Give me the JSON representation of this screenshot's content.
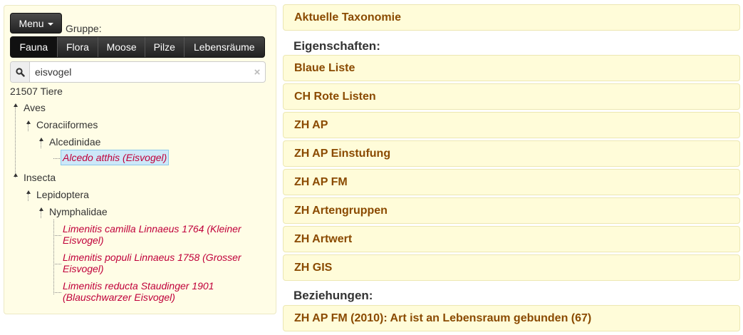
{
  "left": {
    "menu_label": "Menu",
    "gruppe_label": "Gruppe:",
    "groups": [
      "Fauna",
      "Flora",
      "Moose",
      "Pilze",
      "Lebensräume"
    ],
    "active_group": "Fauna",
    "search_value": "eisvogel",
    "count_text": "21507 Tiere",
    "tree": {
      "aves": "Aves",
      "coraciiformes": "Coraciiformes",
      "alcedinidae": "Alcedinidae",
      "alcedo": "Alcedo atthis (Eisvogel)",
      "insecta": "Insecta",
      "lepidoptera": "Lepidoptera",
      "nymphalidae": "Nymphalidae",
      "camilla_1": "Limenitis camilla Linnaeus 1764 (Kleiner",
      "camilla_2": "Eisvogel)",
      "populi_1": "Limenitis populi Linnaeus 1758 (Grosser",
      "populi_2": "Eisvogel)",
      "reducta_1": "Limenitis reducta Staudinger 1901",
      "reducta_2": "(Blauschwarzer Eisvogel)"
    }
  },
  "right": {
    "aktuelle_taxonomie": "Aktuelle Taxonomie",
    "eigenschaften_title": "Eigenschaften:",
    "eigenschaften": [
      "Blaue Liste",
      "CH Rote Listen",
      "ZH AP",
      "ZH AP Einstufung",
      "ZH AP FM",
      "ZH Artengruppen",
      "ZH Artwert",
      "ZH GIS"
    ],
    "beziehungen_title": "Beziehungen:",
    "beziehungen": [
      "ZH AP FM (2010): Art ist an Lebensraum gebunden (67)"
    ]
  },
  "colors": {
    "accordion_bg": "#fffcd9",
    "accordion_text": "#8a4a00",
    "leaf_text": "#c0003a",
    "left_panel_bg": "#fffde6"
  }
}
